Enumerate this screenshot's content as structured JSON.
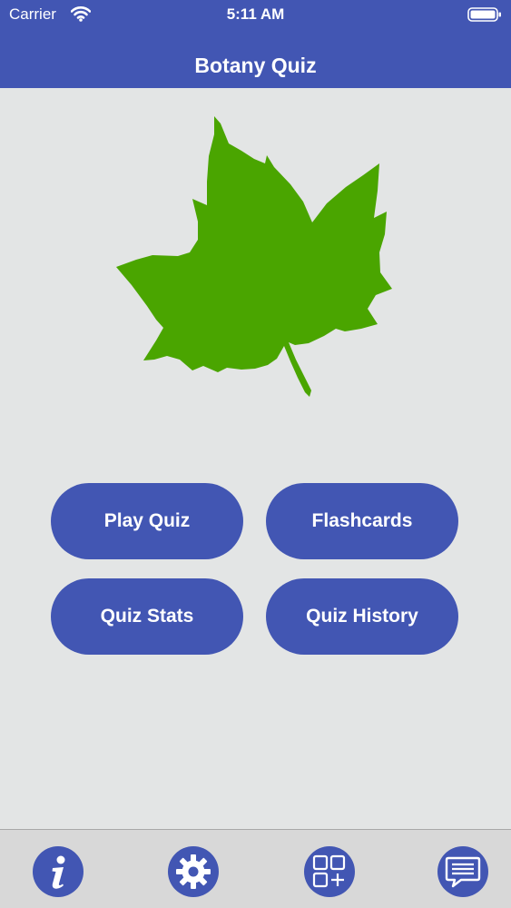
{
  "status_bar": {
    "carrier": "Carrier",
    "time": "5:11 AM",
    "wifi_icon": "wifi-icon",
    "battery_icon": "battery-icon"
  },
  "nav": {
    "title": "Botany Quiz"
  },
  "hero": {
    "icon": "leaf-icon",
    "color": "#4aa500"
  },
  "menu": {
    "play_quiz": "Play Quiz",
    "flashcards": "Flashcards",
    "quiz_stats": "Quiz Stats",
    "quiz_history": "Quiz History"
  },
  "tab_bar": {
    "items": [
      {
        "icon": "info-icon"
      },
      {
        "icon": "gear-icon"
      },
      {
        "icon": "grid-add-icon"
      },
      {
        "icon": "chat-icon"
      }
    ]
  },
  "colors": {
    "primary": "#4256b3",
    "background": "#e3e5e5",
    "tab_bar": "#d8d8d8"
  }
}
